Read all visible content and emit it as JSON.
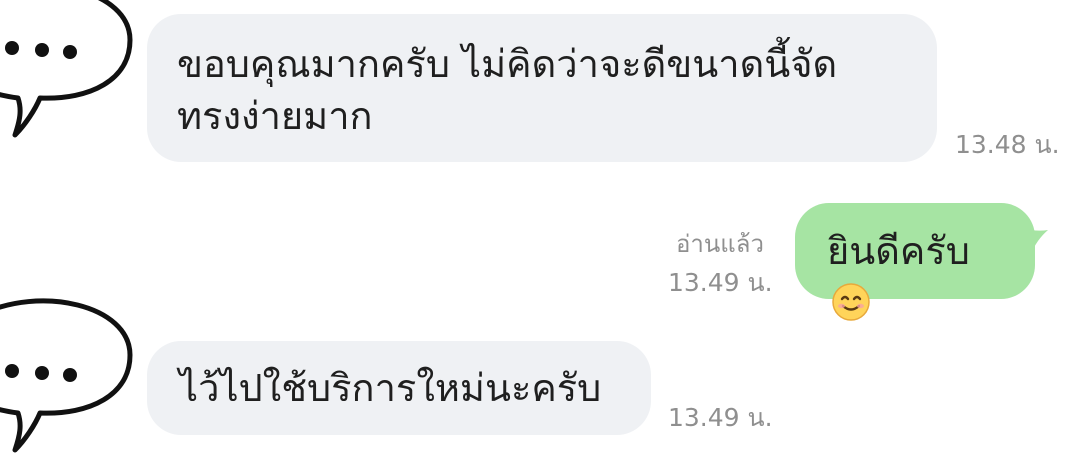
{
  "chat": {
    "messages": [
      {
        "direction": "incoming",
        "lines": [
          "ขอบคุณมากครับ ไม่คิดว่าจะดีขนาดนี้จัด",
          "ทรงง่ายมาก"
        ],
        "time": "13.48 น."
      },
      {
        "direction": "outgoing",
        "text": "ยินดีครับ",
        "emoji": "smiling-face-icon",
        "read_label": "อ่านแล้ว",
        "time": "13.49 น."
      },
      {
        "direction": "incoming",
        "lines": [
          "ไว้ไปใช้บริการใหม่นะครับ"
        ],
        "time": "13.49 น."
      }
    ]
  },
  "colors": {
    "incoming_bubble": "#eff1f4",
    "outgoing_bubble": "#a6e4a3",
    "timestamp": "#8f8f8f",
    "text": "#1f1f1f"
  },
  "icons": {
    "avatar": "speech-bubble-dots-icon"
  }
}
